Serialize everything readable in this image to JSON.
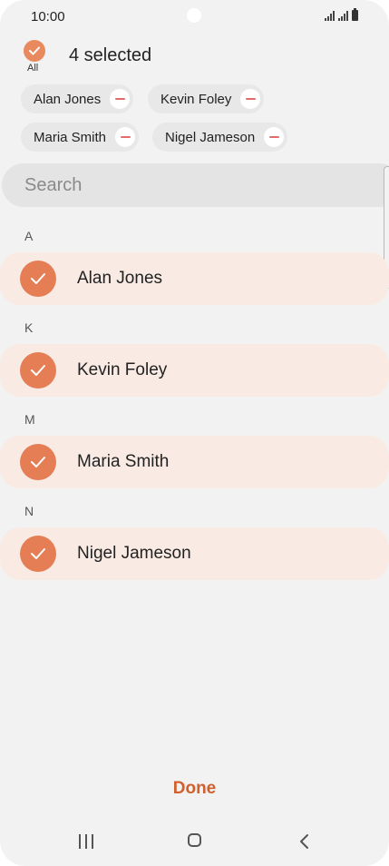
{
  "status_bar": {
    "time": "10:00"
  },
  "header": {
    "all_label": "All",
    "selected_count": "4 selected"
  },
  "chips": [
    {
      "label": "Alan Jones"
    },
    {
      "label": "Kevin Foley"
    },
    {
      "label": "Maria Smith"
    },
    {
      "label": "Nigel Jameson"
    }
  ],
  "search": {
    "placeholder": "Search"
  },
  "sections": [
    {
      "letter": "A",
      "contact": "Alan Jones",
      "checked": true
    },
    {
      "letter": "K",
      "contact": "Kevin Foley",
      "checked": true
    },
    {
      "letter": "M",
      "contact": "Maria Smith",
      "checked": true
    },
    {
      "letter": "N",
      "contact": "Nigel Jameson",
      "checked": true
    }
  ],
  "footer": {
    "done_label": "Done"
  },
  "colors": {
    "accent": "#e57d55",
    "done": "#d0602d",
    "row_bg": "#f9ebe4"
  },
  "icons": {
    "all": "check-circle-icon",
    "chip_remove": "minus-circle-icon",
    "row": "check-circle-icon",
    "nav": [
      "recent-apps-icon",
      "home-icon",
      "back-icon"
    ]
  }
}
